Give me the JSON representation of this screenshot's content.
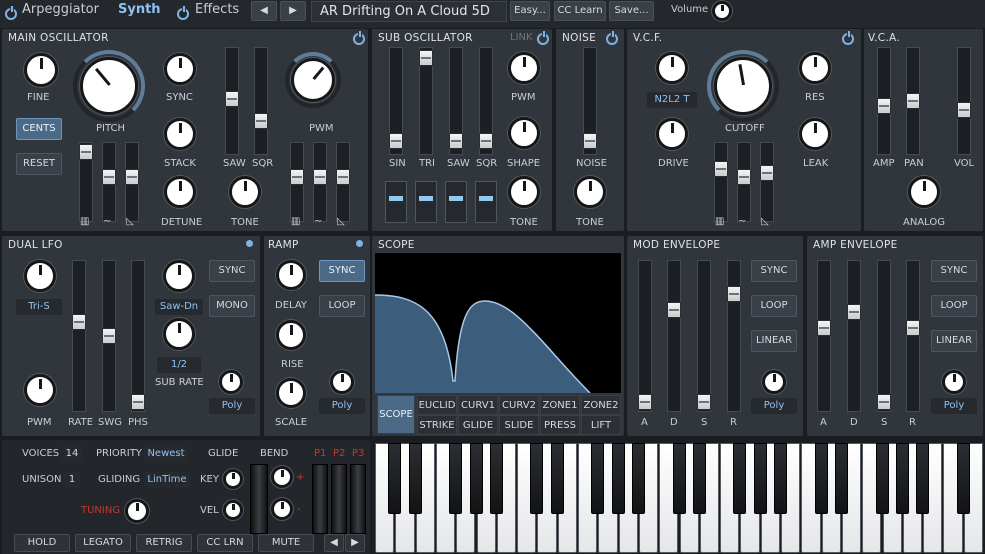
{
  "topbar": {
    "arpeggiator": "Arpeggiator",
    "synth": "Synth",
    "effects": "Effects",
    "preset_name": "AR Drifting On A Cloud 5D",
    "easy": "Easy...",
    "cc_learn": "CC Learn",
    "save": "Save...",
    "volume": "Volume",
    "prev": "◀",
    "next": "▶"
  },
  "main_osc": {
    "title": "MAIN OSCILLATOR",
    "fine": "FINE",
    "cents": "CENTS",
    "reset": "RESET",
    "pitch": "PITCH",
    "sync": "SYNC",
    "stack": "STACK",
    "detune": "DETUNE",
    "saw": "SAW",
    "sqr": "SQR",
    "pwm": "PWM",
    "tone": "TONE"
  },
  "sub_osc": {
    "title": "SUB OSCILLATOR",
    "link": "LINK",
    "sin": "SIN",
    "tri": "TRI",
    "saw": "SAW",
    "sqr": "SQR",
    "pwm": "PWM",
    "shape": "SHAPE",
    "tone": "TONE"
  },
  "noise": {
    "title": "NOISE",
    "noise": "NOISE",
    "tone": "TONE"
  },
  "vcf": {
    "title": "V.C.F.",
    "mode": "N2L2 T",
    "drive": "DRIVE",
    "cutoff": "CUTOFF",
    "res": "RES",
    "leak": "LEAK"
  },
  "vca": {
    "title": "V.C.A.",
    "amp": "AMP",
    "pan": "PAN",
    "vol": "VOL",
    "analog": "ANALOG"
  },
  "dual_lfo": {
    "title": "DUAL LFO",
    "wave1": "Tri-S",
    "wave2": "Saw-Dn",
    "sync": "SYNC",
    "mono": "MONO",
    "ratio": "1/2",
    "sub_rate": "SUB RATE",
    "pwm": "PWM",
    "rate": "RATE",
    "swg": "SWG",
    "phs": "PHS",
    "poly": "Poly"
  },
  "ramp": {
    "title": "RAMP",
    "sync": "SYNC",
    "delay": "DELAY",
    "loop": "LOOP",
    "rise": "RISE",
    "scale": "SCALE",
    "poly": "Poly"
  },
  "scope": {
    "title": "SCOPE",
    "tabs_top": [
      "EUCLID",
      "CURV1",
      "CURV2",
      "ZONE1",
      "ZONE2"
    ],
    "tabs_bottom": [
      "STRIKE",
      "GLIDE",
      "SLIDE",
      "PRESS",
      "LIFT"
    ],
    "active": "SCOPE"
  },
  "mod_env": {
    "title": "MOD ENVELOPE",
    "a": "A",
    "d": "D",
    "s": "S",
    "r": "R",
    "sync": "SYNC",
    "loop": "LOOP",
    "linear": "LINEAR",
    "poly": "Poly"
  },
  "amp_env": {
    "title": "AMP ENVELOPE",
    "a": "A",
    "d": "D",
    "s": "S",
    "r": "R",
    "sync": "SYNC",
    "loop": "LOOP",
    "linear": "LINEAR",
    "poly": "Poly"
  },
  "voice": {
    "voices_label": "VOICES",
    "voices": "14",
    "priority_label": "PRIORITY",
    "priority": "Newest",
    "unison_label": "UNISON",
    "unison": "1",
    "gliding_label": "GLIDING",
    "gliding": "LinTime",
    "glide": "GLIDE",
    "key": "KEY",
    "vel": "VEL",
    "bend": "BEND",
    "plus": "+",
    "minus": "-",
    "tuning": "TUNING",
    "p1": "P1",
    "p2": "P2",
    "p3": "P3"
  },
  "bottom": {
    "hold": "HOLD",
    "legato": "LEGATO",
    "retrig": "RETRIG",
    "cc_lrn": "CC LRN",
    "mute": "MUTE",
    "left": "◀",
    "right": "▶"
  },
  "colors": {
    "accent": "#7fb3e6",
    "tuning": "#c0392b",
    "panel": "#31363c"
  }
}
